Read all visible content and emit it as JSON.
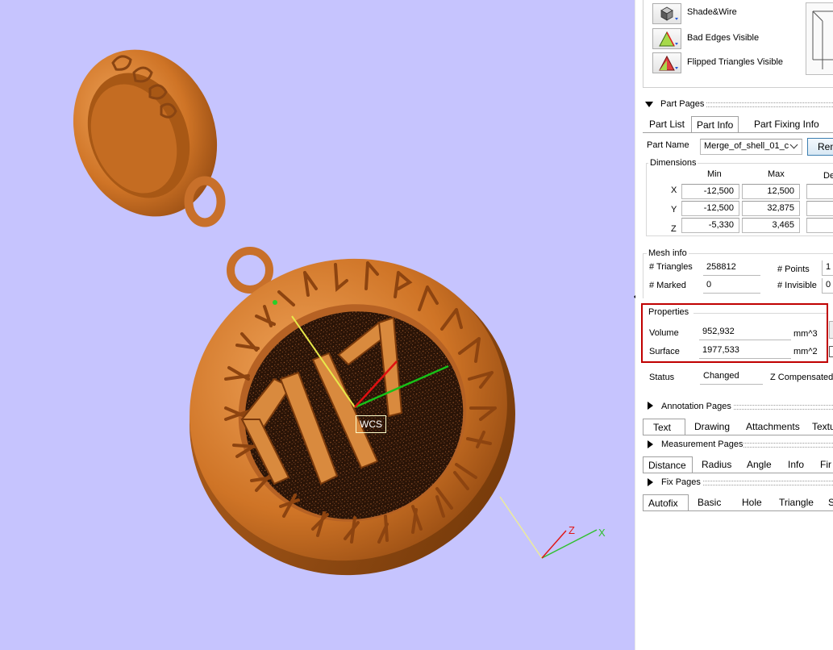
{
  "view_toolbar": {
    "buttons": [
      {
        "label": "Shade&Wire",
        "icon": "shade-wire-cube-icon"
      },
      {
        "label": "Bad Edges Visible",
        "icon": "bad-edges-icon"
      },
      {
        "label": "Flipped Triangles Visible",
        "icon": "flipped-triangles-icon"
      }
    ]
  },
  "part_pages": {
    "title": "Part Pages",
    "tabs": [
      "Part List",
      "Part Info",
      "Part Fixing Info"
    ],
    "active_tab": "Part Info",
    "part_name_label": "Part Name",
    "part_name_value": "Merge_of_shell_01_c",
    "rename_button": "Ren",
    "dimensions": {
      "title": "Dimensions",
      "headers": [
        "Min",
        "Max",
        "De"
      ],
      "rows": [
        {
          "axis": "X",
          "min": "-12,500",
          "max": "12,500"
        },
        {
          "axis": "Y",
          "min": "-12,500",
          "max": "32,875"
        },
        {
          "axis": "Z",
          "min": "-5,330",
          "max": "3,465"
        }
      ]
    },
    "mesh_info": {
      "title": "Mesh info",
      "triangles_label": "# Triangles",
      "triangles_value": "258812",
      "points_label": "# Points",
      "points_value": "1",
      "marked_label": "# Marked",
      "marked_value": "0",
      "invisible_label": "# Invisible",
      "invisible_value": "0"
    },
    "properties": {
      "title": "Properties",
      "volume_label": "Volume",
      "volume_value": "952,932",
      "volume_unit": "mm^3",
      "surface_label": "Surface",
      "surface_value": "1977,533",
      "surface_unit": "mm^2",
      "highlight_color": "#c00000"
    },
    "status_label": "Status",
    "status_value": "Changed",
    "z_compensated_label": "Z Compensated"
  },
  "annotation_pages": {
    "title": "Annotation Pages",
    "tabs": [
      "Text",
      "Drawing",
      "Attachments",
      "Textu"
    ],
    "active_tab": "Text"
  },
  "measurement_pages": {
    "title": "Measurement Pages",
    "tabs": [
      "Distance",
      "Radius",
      "Angle",
      "Info",
      "Fir"
    ],
    "active_tab": "Distance"
  },
  "fix_pages": {
    "title": "Fix Pages",
    "tabs": [
      "Autofix",
      "Basic",
      "Hole",
      "Triangle",
      "She"
    ],
    "active_tab": "Autofix"
  },
  "viewport": {
    "wcs_label": "WCS",
    "axis_z": "Z",
    "axis_x": "X",
    "background": "#c6c4fe",
    "model_color": "#d47a2c"
  }
}
